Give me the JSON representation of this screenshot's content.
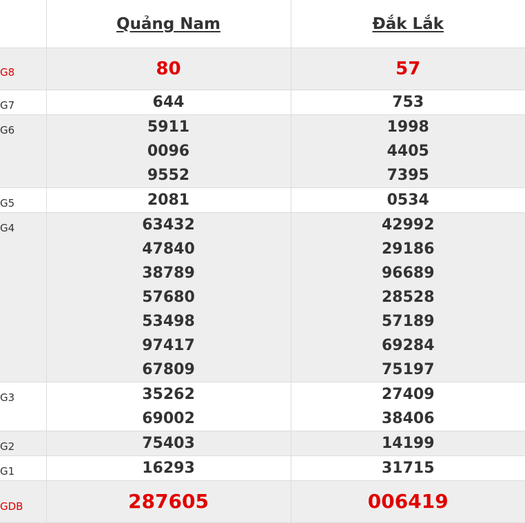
{
  "header": {
    "provinces": [
      "Quảng Nam",
      "Đắk Lắk"
    ]
  },
  "prizes": [
    {
      "label": "G8",
      "a": [
        "80"
      ],
      "b": [
        "57"
      ]
    },
    {
      "label": "G7",
      "a": [
        "644"
      ],
      "b": [
        "753"
      ]
    },
    {
      "label": "G6",
      "a": [
        "5911",
        "0096",
        "9552"
      ],
      "b": [
        "1998",
        "4405",
        "7395"
      ]
    },
    {
      "label": "G5",
      "a": [
        "2081"
      ],
      "b": [
        "0534"
      ]
    },
    {
      "label": "G4",
      "a": [
        "63432",
        "47840",
        "38789",
        "57680",
        "53498",
        "97417",
        "67809"
      ],
      "b": [
        "42992",
        "29186",
        "96689",
        "28528",
        "57189",
        "69284",
        "75197"
      ]
    },
    {
      "label": "G3",
      "a": [
        "35262",
        "69002"
      ],
      "b": [
        "27409",
        "38406"
      ]
    },
    {
      "label": "G2",
      "a": [
        "75403"
      ],
      "b": [
        "14199"
      ]
    },
    {
      "label": "G1",
      "a": [
        "16293"
      ],
      "b": [
        "31715"
      ]
    },
    {
      "label": "GDB",
      "a": [
        "287605"
      ],
      "b": [
        "006419"
      ]
    }
  ],
  "colors": {
    "highlight": "#e00000",
    "text": "#333333",
    "row_shade": "#eeeeee"
  }
}
